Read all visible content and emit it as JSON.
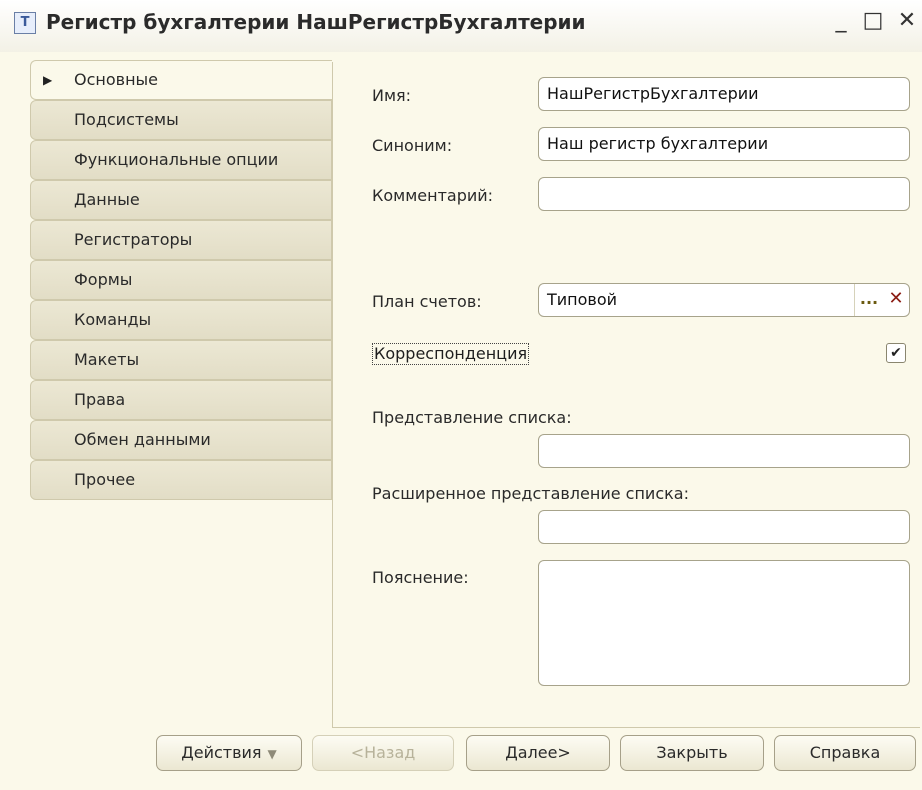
{
  "window": {
    "title": "Регистр бухгалтерии НашРегистрБухгалтерии",
    "minimize": "_",
    "maximize": "□",
    "close": "✕"
  },
  "tabs": [
    {
      "label": "Основные",
      "active": true
    },
    {
      "label": "Подсистемы"
    },
    {
      "label": "Функциональные опции"
    },
    {
      "label": "Данные"
    },
    {
      "label": "Регистраторы"
    },
    {
      "label": "Формы"
    },
    {
      "label": "Команды"
    },
    {
      "label": "Макеты"
    },
    {
      "label": "Права"
    },
    {
      "label": "Обмен данными"
    },
    {
      "label": "Прочее"
    }
  ],
  "form": {
    "name_label": "Имя:",
    "name_value": "НашРегистрБухгалтерии",
    "synonym_label": "Синоним:",
    "synonym_value": "Наш регистр бухгалтерии",
    "comment_label": "Комментарий:",
    "comment_value": "",
    "chart_label": "План счетов:",
    "chart_value": "Типовой",
    "chart_select": "...",
    "chart_clear": "✕",
    "corr_label": "Корреспонденция",
    "corr_checked": true,
    "corr_mark": "✔",
    "list_repr_label": "Представление списка:",
    "list_repr_value": "",
    "ext_list_repr_label": "Расширенное представление списка:",
    "ext_list_repr_value": "",
    "explanation_label": "Пояснение:",
    "explanation_value": ""
  },
  "buttons": {
    "actions": "Действия",
    "actions_arrow": "▼",
    "back": "<Назад",
    "next": "Далее>",
    "close": "Закрыть",
    "help": "Справка"
  },
  "icons": {
    "app": "metadata-icon",
    "tab_pointer": "triangle-right-icon"
  }
}
